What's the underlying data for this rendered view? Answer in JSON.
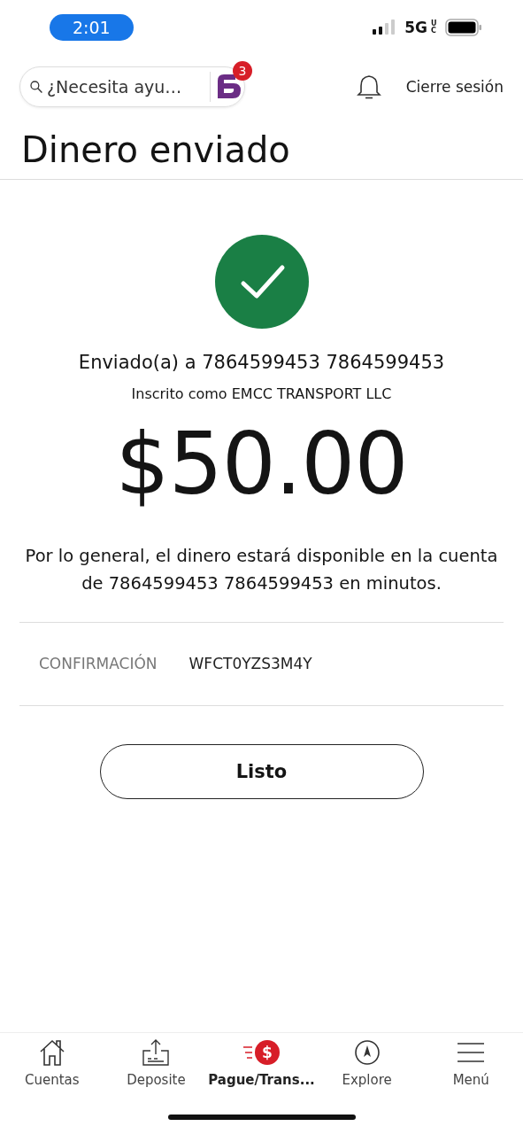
{
  "status_bar": {
    "time": "2:01",
    "network": "5G",
    "network_sub": "UC"
  },
  "header": {
    "search": {
      "placeholder": "¿Necesita ayu…"
    },
    "chat_badge": "3",
    "logout": "Cierre sesión"
  },
  "title": "Dinero enviado",
  "confirmation": {
    "sent_to": "Enviado(a) a 7864599453 7864599453",
    "enrolled_as": "Inscrito como EMCC TRANSPORT LLC",
    "amount": "$50.00",
    "note": "Por lo general, el dinero estará disponible en la cuenta de 7864599453 7864599453 en minutos.",
    "label": "CONFIRMACIÓN",
    "code": "WFCT0YZS3M4Y",
    "button": "Listo"
  },
  "tabs": [
    {
      "kind": "home",
      "label": "Cuentas",
      "selected": false
    },
    {
      "kind": "deposit",
      "label": "Deposite",
      "selected": false
    },
    {
      "kind": "pay",
      "label": "Pague/Trans...",
      "icon_text": "$",
      "selected": true
    },
    {
      "kind": "explore",
      "label": "Explore",
      "selected": false
    },
    {
      "kind": "menu",
      "label": "Menú",
      "selected": false
    }
  ]
}
